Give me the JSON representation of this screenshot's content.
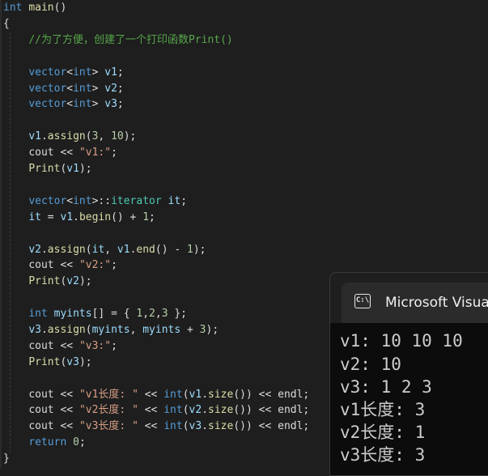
{
  "colors": {
    "editor_background": "#1e1e1e",
    "keyword": "#569cd6",
    "function": "#dcdcaa",
    "variable": "#9cdcfe",
    "string": "#d69d85",
    "number": "#b5cea8",
    "comment": "#57a64a",
    "console_background": "#0c0c0c"
  },
  "editor": {
    "lines": [
      [
        [
          "kw",
          "int"
        ],
        [
          "pl",
          " "
        ],
        [
          "fn",
          "main"
        ],
        [
          "pl",
          "()"
        ]
      ],
      [
        [
          "pl",
          "{"
        ]
      ],
      [
        [
          "pl",
          "    "
        ],
        [
          "cmt",
          "//为了方便，创建了一个打印函数Print()"
        ]
      ],
      [],
      [
        [
          "pl",
          "    "
        ],
        [
          "kw",
          "vector"
        ],
        [
          "pl",
          "<"
        ],
        [
          "kw",
          "int"
        ],
        [
          "pl",
          "> "
        ],
        [
          "var",
          "v1"
        ],
        [
          "pl",
          ";"
        ]
      ],
      [
        [
          "pl",
          "    "
        ],
        [
          "kw",
          "vector"
        ],
        [
          "pl",
          "<"
        ],
        [
          "kw",
          "int"
        ],
        [
          "pl",
          "> "
        ],
        [
          "var",
          "v2"
        ],
        [
          "pl",
          ";"
        ]
      ],
      [
        [
          "pl",
          "    "
        ],
        [
          "kw",
          "vector"
        ],
        [
          "pl",
          "<"
        ],
        [
          "kw",
          "int"
        ],
        [
          "pl",
          "> "
        ],
        [
          "var",
          "v3"
        ],
        [
          "pl",
          ";"
        ]
      ],
      [],
      [
        [
          "pl",
          "    "
        ],
        [
          "var",
          "v1"
        ],
        [
          "pl",
          "."
        ],
        [
          "fn",
          "assign"
        ],
        [
          "pl",
          "("
        ],
        [
          "num",
          "3"
        ],
        [
          "pl",
          ", "
        ],
        [
          "num",
          "10"
        ],
        [
          "pl",
          ");"
        ]
      ],
      [
        [
          "pl",
          "    "
        ],
        [
          "pl",
          "cout << "
        ],
        [
          "str",
          "\"v1:\""
        ],
        [
          "pl",
          ";"
        ]
      ],
      [
        [
          "pl",
          "    "
        ],
        [
          "fn",
          "Print"
        ],
        [
          "pl",
          "("
        ],
        [
          "var",
          "v1"
        ],
        [
          "pl",
          ");"
        ]
      ],
      [],
      [
        [
          "pl",
          "    "
        ],
        [
          "kw",
          "vector"
        ],
        [
          "pl",
          "<"
        ],
        [
          "kw",
          "int"
        ],
        [
          "pl",
          ">::"
        ],
        [
          "ty",
          "iterator"
        ],
        [
          "pl",
          " "
        ],
        [
          "var",
          "it"
        ],
        [
          "pl",
          ";"
        ]
      ],
      [
        [
          "pl",
          "    "
        ],
        [
          "var",
          "it"
        ],
        [
          "pl",
          " = "
        ],
        [
          "var",
          "v1"
        ],
        [
          "pl",
          "."
        ],
        [
          "fn",
          "begin"
        ],
        [
          "pl",
          "() + "
        ],
        [
          "num",
          "1"
        ],
        [
          "pl",
          ";"
        ]
      ],
      [],
      [
        [
          "pl",
          "    "
        ],
        [
          "var",
          "v2"
        ],
        [
          "pl",
          "."
        ],
        [
          "fn",
          "assign"
        ],
        [
          "pl",
          "("
        ],
        [
          "var",
          "it"
        ],
        [
          "pl",
          ", "
        ],
        [
          "var",
          "v1"
        ],
        [
          "pl",
          "."
        ],
        [
          "fn",
          "end"
        ],
        [
          "pl",
          "() - "
        ],
        [
          "num",
          "1"
        ],
        [
          "pl",
          ");"
        ]
      ],
      [
        [
          "pl",
          "    "
        ],
        [
          "pl",
          "cout << "
        ],
        [
          "str",
          "\"v2:\""
        ],
        [
          "pl",
          ";"
        ]
      ],
      [
        [
          "pl",
          "    "
        ],
        [
          "fn",
          "Print"
        ],
        [
          "pl",
          "("
        ],
        [
          "var",
          "v2"
        ],
        [
          "pl",
          ");"
        ]
      ],
      [],
      [
        [
          "pl",
          "    "
        ],
        [
          "kw",
          "int"
        ],
        [
          "pl",
          " "
        ],
        [
          "var",
          "myints"
        ],
        [
          "pl",
          "[] = { "
        ],
        [
          "num",
          "1"
        ],
        [
          "pl",
          ","
        ],
        [
          "num",
          "2"
        ],
        [
          "pl",
          ","
        ],
        [
          "num",
          "3"
        ],
        [
          "pl",
          " };"
        ]
      ],
      [
        [
          "pl",
          "    "
        ],
        [
          "var",
          "v3"
        ],
        [
          "pl",
          "."
        ],
        [
          "fn",
          "assign"
        ],
        [
          "pl",
          "("
        ],
        [
          "var",
          "myints"
        ],
        [
          "pl",
          ", "
        ],
        [
          "var",
          "myints"
        ],
        [
          "pl",
          " + "
        ],
        [
          "num",
          "3"
        ],
        [
          "pl",
          ");"
        ]
      ],
      [
        [
          "pl",
          "    "
        ],
        [
          "pl",
          "cout << "
        ],
        [
          "str",
          "\"v3:\""
        ],
        [
          "pl",
          ";"
        ]
      ],
      [
        [
          "pl",
          "    "
        ],
        [
          "fn",
          "Print"
        ],
        [
          "pl",
          "("
        ],
        [
          "var",
          "v3"
        ],
        [
          "pl",
          ");"
        ]
      ],
      [],
      [
        [
          "pl",
          "    "
        ],
        [
          "pl",
          "cout << "
        ],
        [
          "str",
          "\"v1长度: \""
        ],
        [
          "pl",
          " << "
        ],
        [
          "kw",
          "int"
        ],
        [
          "pl",
          "("
        ],
        [
          "var",
          "v1"
        ],
        [
          "pl",
          "."
        ],
        [
          "fn",
          "size"
        ],
        [
          "pl",
          "()) << endl;"
        ]
      ],
      [
        [
          "pl",
          "    "
        ],
        [
          "pl",
          "cout << "
        ],
        [
          "str",
          "\"v2长度: \""
        ],
        [
          "pl",
          " << "
        ],
        [
          "kw",
          "int"
        ],
        [
          "pl",
          "("
        ],
        [
          "var",
          "v2"
        ],
        [
          "pl",
          "."
        ],
        [
          "fn",
          "size"
        ],
        [
          "pl",
          "()) << endl;"
        ]
      ],
      [
        [
          "pl",
          "    "
        ],
        [
          "pl",
          "cout << "
        ],
        [
          "str",
          "\"v3长度: \""
        ],
        [
          "pl",
          " << "
        ],
        [
          "kw",
          "int"
        ],
        [
          "pl",
          "("
        ],
        [
          "var",
          "v3"
        ],
        [
          "pl",
          "."
        ],
        [
          "fn",
          "size"
        ],
        [
          "pl",
          "()) << endl;"
        ]
      ],
      [
        [
          "pl",
          "    "
        ],
        [
          "kw",
          "return"
        ],
        [
          "pl",
          " "
        ],
        [
          "num",
          "0"
        ],
        [
          "pl",
          ";"
        ]
      ],
      [
        [
          "pl",
          "}"
        ]
      ]
    ]
  },
  "console": {
    "icon": "terminal-icon",
    "icon_text": "C:\\",
    "title": "Microsoft Visua",
    "output": [
      "v1: 10 10 10",
      "v2: 10",
      "v3: 1 2 3",
      "v1长度: 3",
      "v2长度: 1",
      "v3长度: 3"
    ]
  }
}
